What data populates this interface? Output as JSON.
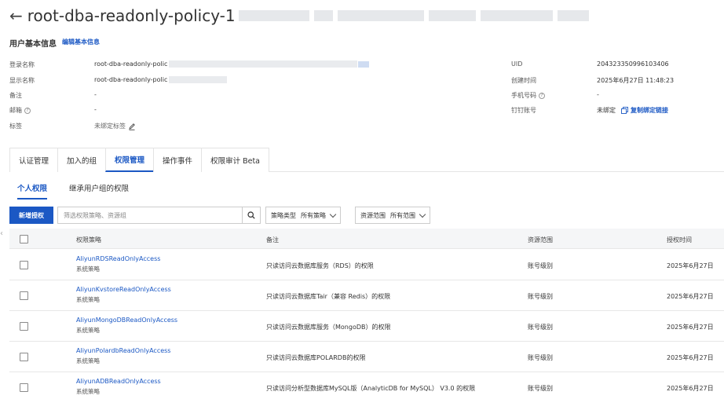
{
  "header": {
    "title": "root-dba-readonly-policy-1"
  },
  "basic_info": {
    "section_title": "用户基本信息",
    "edit_link": "编辑基本信息",
    "left": [
      {
        "label": "登录名称",
        "value": "root-dba-readonly-polic"
      },
      {
        "label": "显示名称",
        "value": "root-dba-readonly-polic"
      },
      {
        "label": "备注",
        "value": "-"
      },
      {
        "label": "邮箱",
        "value": "-"
      },
      {
        "label": "标签",
        "value": "未绑定标签"
      }
    ],
    "right": [
      {
        "label": "UID",
        "value": "204323350996103406"
      },
      {
        "label": "创建时间",
        "value": "2025年6月27日 11:48:23"
      },
      {
        "label": "手机号码",
        "value": "-"
      },
      {
        "label": "钉钉账号",
        "value": "未绑定",
        "link": "复制绑定链接"
      }
    ]
  },
  "tabs": [
    {
      "label": "认证管理"
    },
    {
      "label": "加入的组"
    },
    {
      "label": "权限管理"
    },
    {
      "label": "操作事件"
    },
    {
      "label": "权限审计 Beta"
    }
  ],
  "subtabs": [
    {
      "label": "个人权限"
    },
    {
      "label": "继承用户组的权限"
    }
  ],
  "toolbar": {
    "add_button": "新增授权",
    "search_placeholder": "筛选权限策略、资源组",
    "filter_policy_type_key": "策略类型",
    "filter_policy_type_value": "所有策略",
    "filter_scope_key": "资源范围",
    "filter_scope_value": "所有范围"
  },
  "table": {
    "columns": [
      "权限策略",
      "备注",
      "资源范围",
      "授权时间"
    ],
    "rows": [
      {
        "policy": "AliyunRDSReadOnlyAccess",
        "type": "系统策略",
        "remark": "只读访问云数据库服务（RDS）的权限",
        "scope": "账号级别",
        "time": "2025年6月27日"
      },
      {
        "policy": "AliyunKvstoreReadOnlyAccess",
        "type": "系统策略",
        "remark": "只读访问云数据库Tair（兼容 Redis）的权限",
        "scope": "账号级别",
        "time": "2025年6月27日"
      },
      {
        "policy": "AliyunMongoDBReadOnlyAccess",
        "type": "系统策略",
        "remark": "只读访问云数据库服务（MongoDB）的权限",
        "scope": "账号级别",
        "time": "2025年6月27日"
      },
      {
        "policy": "AliyunPolardbReadOnlyAccess",
        "type": "系统策略",
        "remark": "只读访问云数据库POLARDB的权限",
        "scope": "账号级别",
        "time": "2025年6月27日"
      },
      {
        "policy": "AliyunADBReadOnlyAccess",
        "type": "系统策略",
        "remark": "只读访问分析型数据库MySQL版（AnalyticDB for MySQL） V3.0 的权限",
        "scope": "账号级别",
        "time": "2025年6月27日"
      }
    ]
  },
  "colors": {
    "primary": "#1b58c4"
  }
}
